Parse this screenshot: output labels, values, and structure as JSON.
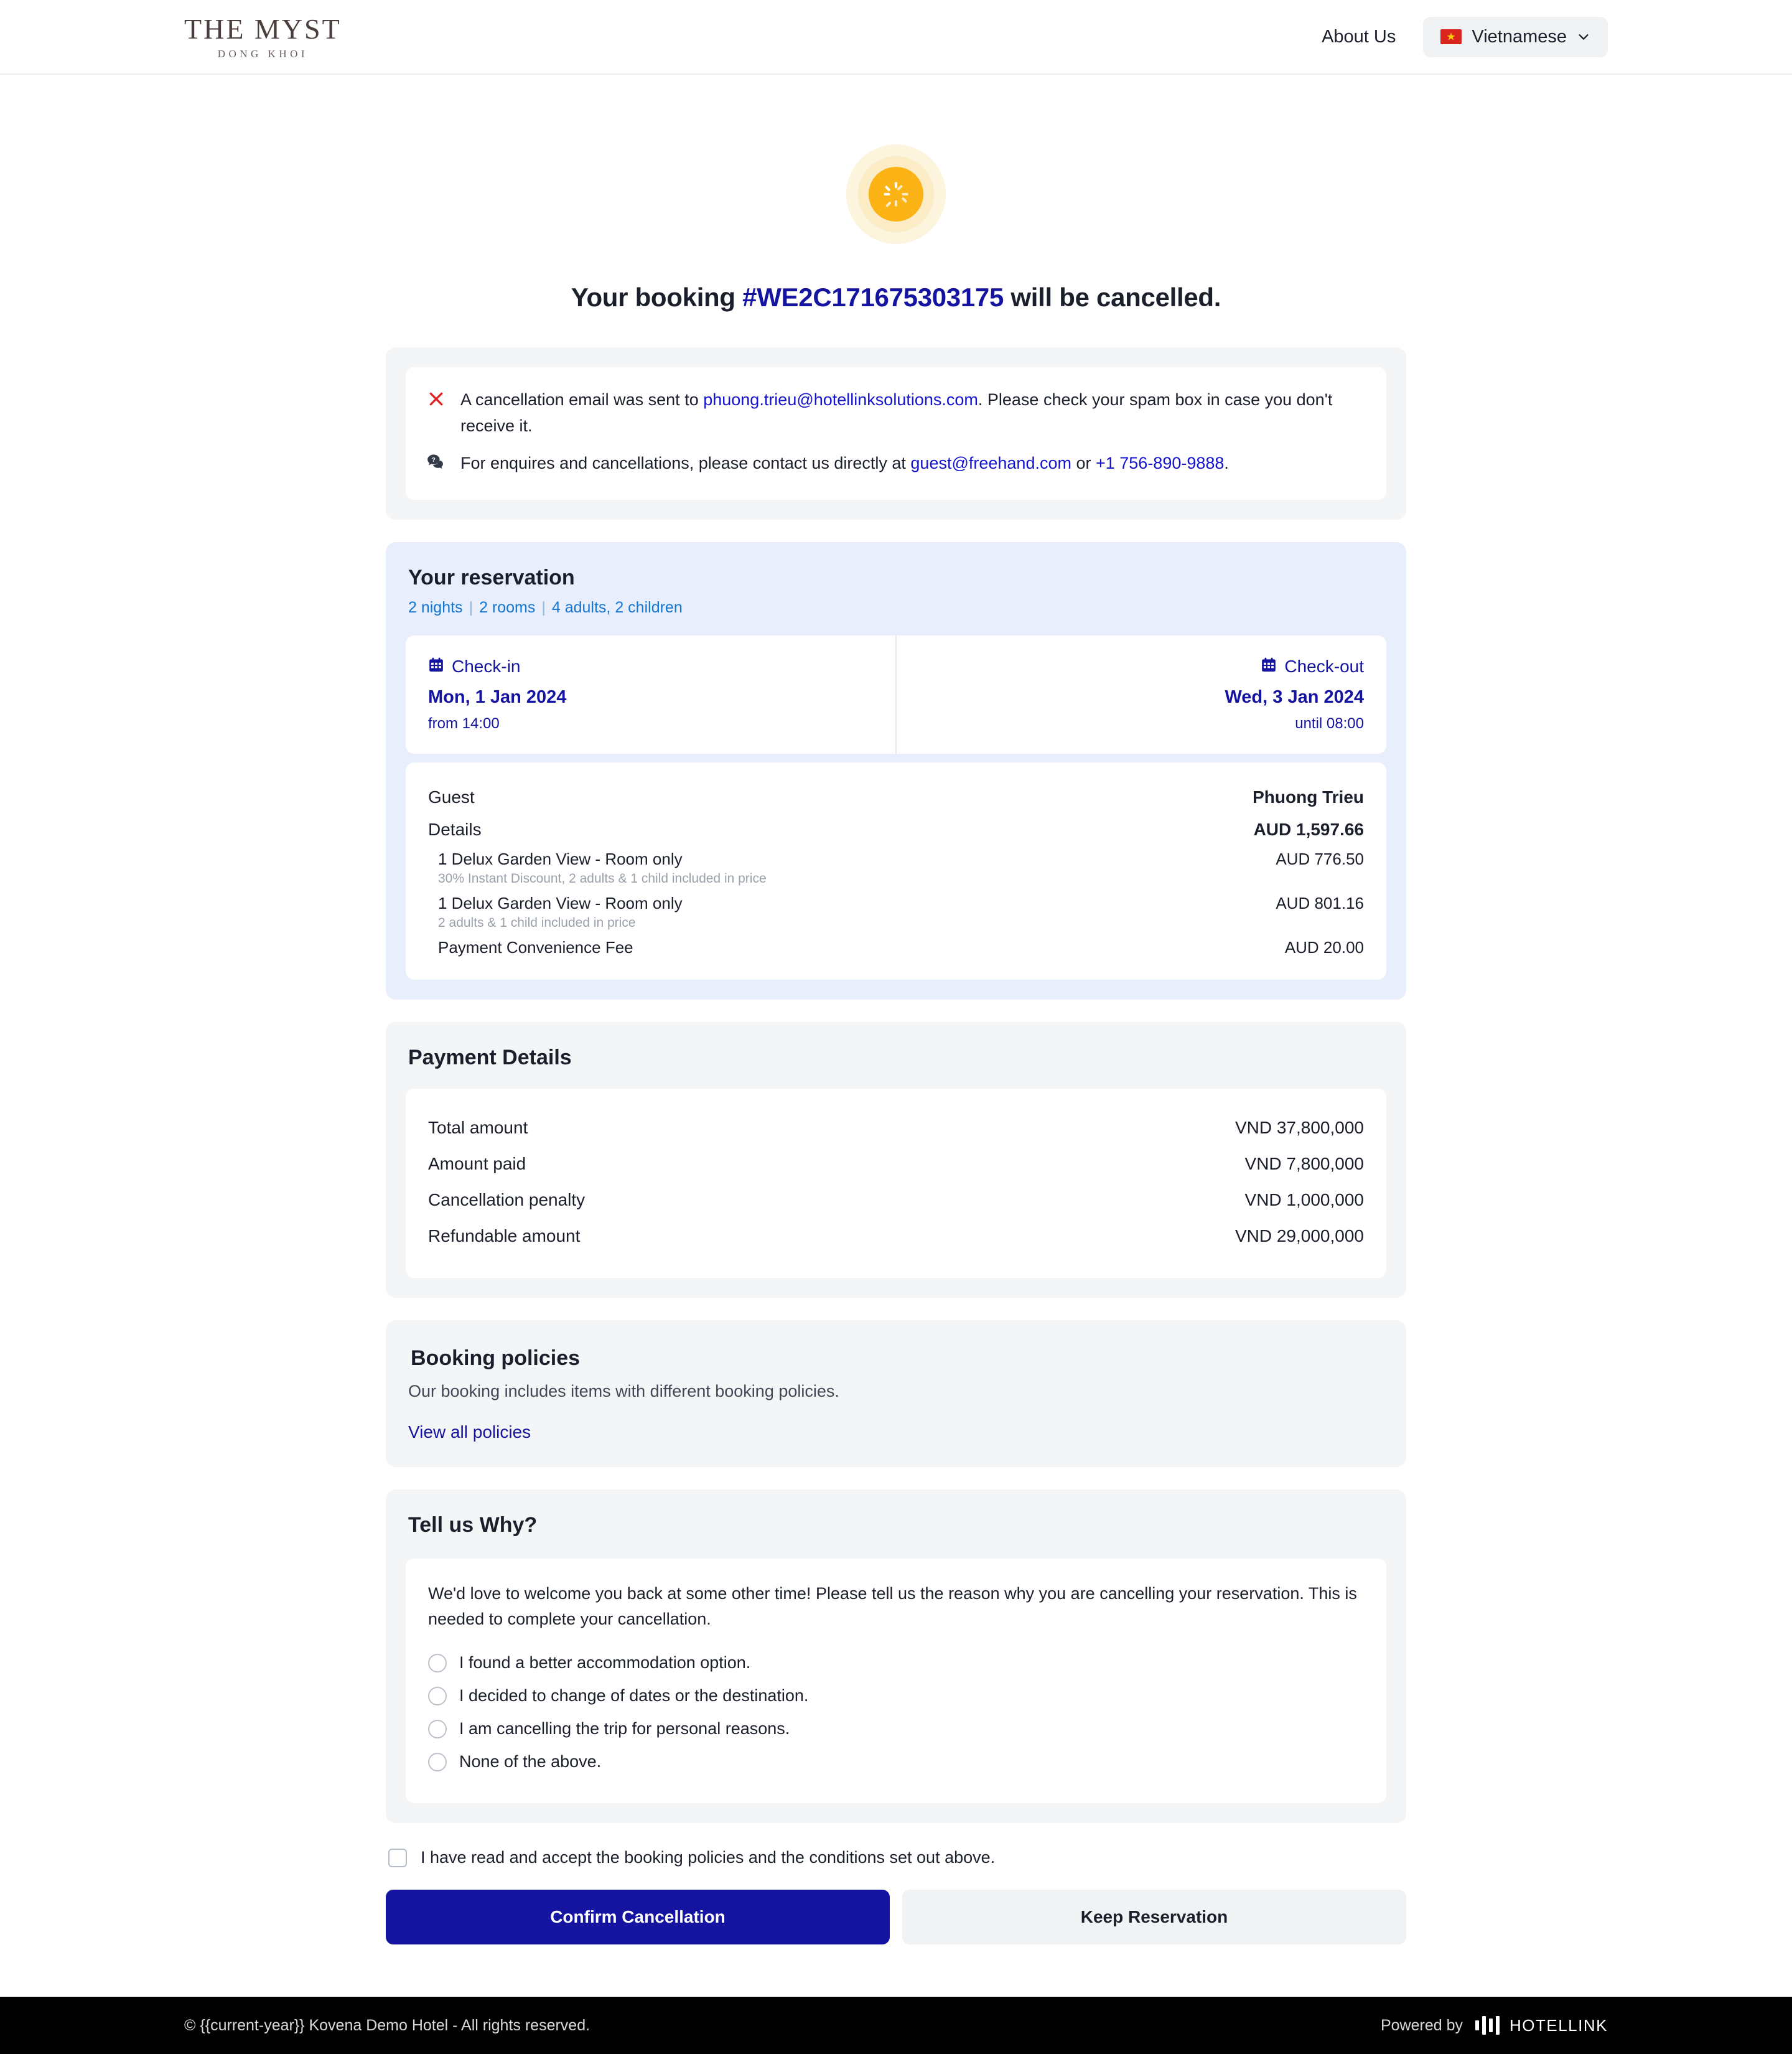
{
  "header": {
    "logo_main": "THE MYST",
    "logo_sub": "DONG KHOI",
    "about_label": "About Us",
    "language_label": "Vietnamese",
    "language_flag": "vietnam-flag-icon",
    "chevron": "chevron-down-icon"
  },
  "status": {
    "icon": "spinner-icon",
    "icon_color": "#fcb316",
    "headline_prefix": "Your booking ",
    "booking_code": "#WE2C171675303175",
    "headline_suffix": " will be cancelled."
  },
  "alert": {
    "line1_icon": "x-mark-icon",
    "line1_part1": "A cancellation email was sent to ",
    "line1_email": "phuong.trieu@hotellinksolutions.com",
    "line1_part2": ". Please check your spam box in case you don't receive it.",
    "line2_icon": "chat-question-icon",
    "line2_part1": "For enquires and cancellations, please contact us directly at ",
    "line2_email": "guest@freehand.com",
    "line2_or": " or ",
    "line2_phone": "+1 756-890-9888",
    "line2_end": "."
  },
  "reservation": {
    "title": "Your reservation",
    "nights": "2 nights",
    "rooms": "2 rooms",
    "occupancy": "4 adults, 2 children",
    "checkin": {
      "icon": "calendar-icon",
      "label": "Check-in",
      "date": "Mon, 1 Jan 2024",
      "time": "from 14:00"
    },
    "checkout": {
      "icon": "calendar-icon",
      "label": "Check-out",
      "date": "Wed, 3 Jan 2024",
      "time": "until 08:00"
    },
    "guest_label": "Guest",
    "guest_name": "Phuong Trieu",
    "details_label": "Details",
    "details_total": "AUD 1,597.66",
    "items": [
      {
        "name": "1 Delux Garden View - Room only",
        "price": "AUD 776.50",
        "note": "30% Instant Discount, 2 adults & 1 child included in price"
      },
      {
        "name": "1 Delux Garden View - Room only",
        "price": "AUD 801.16",
        "note": "2 adults & 1 child included in price"
      },
      {
        "name": "Payment Convenience Fee",
        "price": "AUD 20.00",
        "note": ""
      }
    ]
  },
  "payment": {
    "title": "Payment Details",
    "rows": [
      {
        "label": "Total amount",
        "value": "VND 37,800,000"
      },
      {
        "label": "Amount paid",
        "value": "VND 7,800,000"
      },
      {
        "label": "Cancellation penalty",
        "value": "VND 1,000,000"
      },
      {
        "label": "Refundable amount",
        "value": "VND 29,000,000"
      }
    ]
  },
  "policies": {
    "title": "Booking policies",
    "description": "Our booking includes items with different booking policies.",
    "link_label": "View all policies"
  },
  "why": {
    "title": "Tell us Why?",
    "intro": "We'd love to welcome you back at some other time! Please tell us the reason why you are cancelling your reservation. This is needed to complete your cancellation.",
    "options": [
      "I found a better accommodation option.",
      "I decided to change of dates or the destination.",
      "I am cancelling the trip for personal reasons.",
      "None of the above."
    ]
  },
  "actions": {
    "accept_label": "I have read and accept the booking policies and the conditions set out above.",
    "confirm_label": "Confirm Cancellation",
    "keep_label": "Keep Reservation",
    "confirm_color": "#1414a0"
  },
  "footer": {
    "copyright": "© {{current-year}} Kovena Demo Hotel - All rights reserved.",
    "powered_by": "Powered by",
    "brand": "HOTELLINK"
  }
}
